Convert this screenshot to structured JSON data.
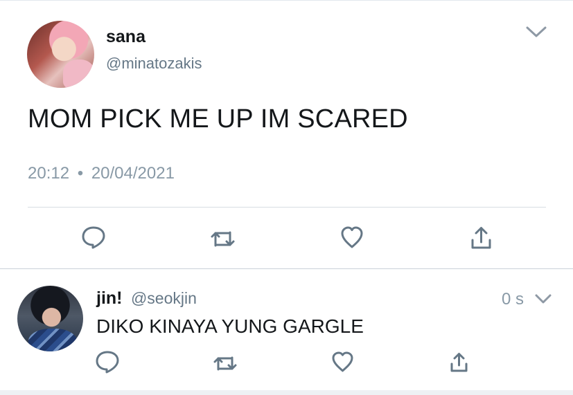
{
  "main_tweet": {
    "name": "sana",
    "handle": "@minatozakis",
    "text": "MOM PICK ME UP IM SCARED",
    "time": "20:12",
    "separator": "•",
    "date": "20/04/2021",
    "icons": {
      "menu": "chevron-down-icon",
      "reply": "reply-icon",
      "retweet": "retweet-icon",
      "like": "heart-icon",
      "share": "share-icon"
    }
  },
  "reply_tweet": {
    "name": "jin!",
    "handle": "@seokjin",
    "time": "0 s",
    "text": "DIKO KINAYA YUNG GARGLE",
    "icons": {
      "menu": "chevron-down-icon",
      "reply": "reply-icon",
      "retweet": "retweet-icon",
      "like": "heart-icon",
      "share": "share-icon"
    }
  },
  "colors": {
    "text": "#14171a",
    "secondary_text": "#657786",
    "muted_text": "#8899a6",
    "icon": "#657786",
    "divider": "#d7dde2",
    "bottom_bar": "#eef1f4"
  }
}
